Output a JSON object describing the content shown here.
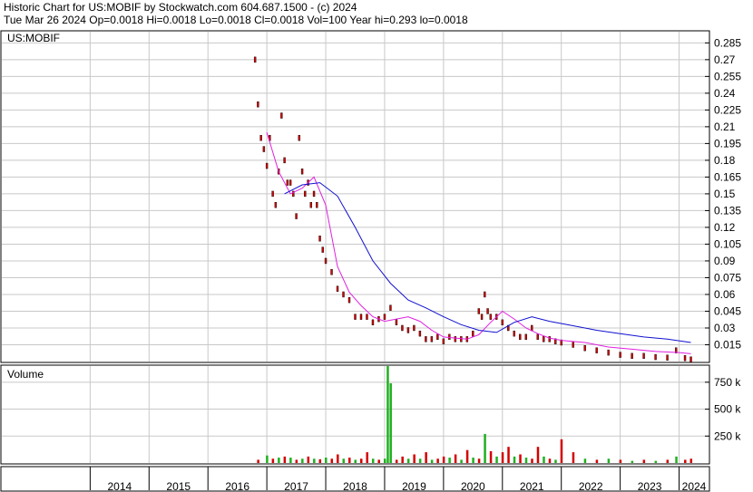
{
  "header": {
    "title_line": "Historic Chart for US:MOBIF by Stockwatch.com 604.687.1500 - (c) 2024",
    "quote_line": "Tue Mar 26 2024  Op=0.0018  Hi=0.0018  Lo=0.0018  Cl=0.0018  Vol=100  Year hi=0.293  lo=0.0018"
  },
  "chart_data": [
    {
      "type": "line",
      "panel": "price",
      "title": "US:MOBIF",
      "y_tick_labels": [
        "0.285",
        "0.27",
        "0.255",
        "0.24",
        "0.225",
        "0.21",
        "0.195",
        "0.18",
        "0.165",
        "0.15",
        "0.135",
        "0.12",
        "0.105",
        "0.09",
        "0.075",
        "0.06",
        "0.045",
        "0.03",
        "0.015"
      ],
      "ylim": [
        0,
        0.295
      ],
      "x_tick_labels": [
        "2014",
        "2015",
        "2016",
        "2017",
        "2018",
        "2019",
        "2020",
        "2021",
        "2022",
        "2023",
        "2024"
      ],
      "grid": true,
      "colors": {
        "bars": "#d40000",
        "bar_outline": "#000000",
        "ma_short": "#e020e0",
        "ma_long": "#1010d0",
        "grid": "#c8c8c8"
      },
      "series": [
        {
          "kind": "price",
          "x": [
            2016.8,
            2016.85,
            2016.9,
            2016.95,
            2017.0,
            2017.05,
            2017.1,
            2017.15,
            2017.2,
            2017.25,
            2017.3,
            2017.35,
            2017.4,
            2017.45,
            2017.5,
            2017.55,
            2017.6,
            2017.65,
            2017.7,
            2017.75,
            2017.8,
            2017.85,
            2017.9,
            2017.95,
            2018.0,
            2018.1,
            2018.2,
            2018.3,
            2018.4,
            2018.5,
            2018.6,
            2018.7,
            2018.8,
            2018.9,
            2019.0,
            2019.1,
            2019.2,
            2019.3,
            2019.4,
            2019.5,
            2019.6,
            2019.7,
            2019.8,
            2019.9,
            2020.0,
            2020.1,
            2020.2,
            2020.3,
            2020.4,
            2020.5,
            2020.6,
            2020.65,
            2020.7,
            2020.75,
            2020.8,
            2020.9,
            2021.0,
            2021.1,
            2021.2,
            2021.3,
            2021.4,
            2021.5,
            2021.6,
            2021.7,
            2021.8,
            2021.9,
            2022.0,
            2022.2,
            2022.4,
            2022.6,
            2022.8,
            2023.0,
            2023.2,
            2023.4,
            2023.6,
            2023.8,
            2023.95,
            2024.1,
            2024.2
          ],
          "y": [
            0.27,
            0.23,
            0.2,
            0.19,
            0.175,
            0.2,
            0.15,
            0.14,
            0.17,
            0.22,
            0.18,
            0.16,
            0.16,
            0.15,
            0.13,
            0.2,
            0.17,
            0.15,
            0.16,
            0.14,
            0.15,
            0.14,
            0.11,
            0.1,
            0.09,
            0.08,
            0.065,
            0.06,
            0.055,
            0.04,
            0.04,
            0.04,
            0.035,
            0.038,
            0.04,
            0.048,
            0.035,
            0.03,
            0.028,
            0.03,
            0.025,
            0.02,
            0.02,
            0.022,
            0.018,
            0.022,
            0.02,
            0.02,
            0.02,
            0.025,
            0.045,
            0.04,
            0.06,
            0.045,
            0.04,
            0.04,
            0.035,
            0.03,
            0.025,
            0.022,
            0.022,
            0.03,
            0.022,
            0.02,
            0.02,
            0.018,
            0.017,
            0.015,
            0.012,
            0.01,
            0.008,
            0.006,
            0.005,
            0.005,
            0.004,
            0.0035,
            0.01,
            0.003,
            0.0018
          ]
        },
        {
          "name": "",
          "kind": "short_moving_average",
          "x": [
            2017.0,
            2017.2,
            2017.4,
            2017.6,
            2017.8,
            2018.0,
            2018.2,
            2018.4,
            2018.6,
            2018.8,
            2019.0,
            2019.2,
            2019.4,
            2019.6,
            2019.8,
            2020.0,
            2020.2,
            2020.4,
            2020.6,
            2020.8,
            2021.0,
            2021.2,
            2021.4,
            2021.6,
            2021.8,
            2022.0,
            2022.4,
            2022.8,
            2023.2,
            2023.6,
            2024.0,
            2024.2
          ],
          "y": [
            0.205,
            0.17,
            0.15,
            0.155,
            0.165,
            0.14,
            0.085,
            0.062,
            0.05,
            0.04,
            0.036,
            0.038,
            0.04,
            0.036,
            0.028,
            0.022,
            0.021,
            0.02,
            0.024,
            0.035,
            0.045,
            0.038,
            0.03,
            0.025,
            0.021,
            0.019,
            0.017,
            0.013,
            0.011,
            0.009,
            0.008,
            0.007
          ]
        },
        {
          "name": "",
          "kind": "long_moving_average",
          "x": [
            2017.3,
            2017.6,
            2017.9,
            2018.2,
            2018.5,
            2018.8,
            2019.1,
            2019.4,
            2019.7,
            2020.0,
            2020.3,
            2020.6,
            2020.9,
            2021.2,
            2021.5,
            2021.8,
            2022.2,
            2022.6,
            2023.0,
            2023.4,
            2023.8,
            2024.2
          ],
          "y": [
            0.15,
            0.158,
            0.16,
            0.148,
            0.12,
            0.09,
            0.07,
            0.055,
            0.048,
            0.04,
            0.033,
            0.028,
            0.026,
            0.035,
            0.04,
            0.036,
            0.032,
            0.028,
            0.025,
            0.022,
            0.02,
            0.017
          ]
        }
      ]
    },
    {
      "type": "bar",
      "panel": "volume",
      "title": "Volume",
      "y_tick_labels": [
        "750 k",
        "500 k",
        "250 k"
      ],
      "ylim": [
        0,
        900000
      ],
      "colors": {
        "up": "#20b020",
        "down": "#d40000"
      },
      "x": [
        2016.85,
        2017.0,
        2017.1,
        2017.2,
        2017.3,
        2017.4,
        2017.5,
        2017.6,
        2017.7,
        2017.8,
        2017.9,
        2018.0,
        2018.1,
        2018.2,
        2018.3,
        2018.4,
        2018.5,
        2018.6,
        2018.7,
        2018.8,
        2018.9,
        2019.0,
        2019.05,
        2019.1,
        2019.2,
        2019.3,
        2019.4,
        2019.5,
        2019.6,
        2019.7,
        2019.8,
        2019.9,
        2020.0,
        2020.1,
        2020.2,
        2020.3,
        2020.4,
        2020.5,
        2020.6,
        2020.7,
        2020.8,
        2020.9,
        2021.0,
        2021.1,
        2021.2,
        2021.3,
        2021.4,
        2021.5,
        2021.6,
        2021.7,
        2021.8,
        2021.9,
        2022.0,
        2022.2,
        2022.4,
        2022.6,
        2022.8,
        2023.0,
        2023.2,
        2023.4,
        2023.6,
        2023.8,
        2023.95,
        2024.1,
        2024.2
      ],
      "values": [
        30000,
        70000,
        40000,
        50000,
        60000,
        50000,
        30000,
        40000,
        60000,
        40000,
        35000,
        50000,
        40000,
        80000,
        40000,
        50000,
        30000,
        40000,
        100000,
        40000,
        30000,
        40000,
        900000,
        740000,
        30000,
        60000,
        40000,
        80000,
        40000,
        100000,
        30000,
        40000,
        60000,
        50000,
        80000,
        30000,
        120000,
        50000,
        40000,
        270000,
        110000,
        60000,
        100000,
        150000,
        60000,
        80000,
        50000,
        40000,
        150000,
        60000,
        40000,
        30000,
        220000,
        100000,
        40000,
        30000,
        40000,
        30000,
        20000,
        30000,
        20000,
        30000,
        60000,
        30000,
        40000
      ],
      "direction": [
        "down",
        "up",
        "down",
        "up",
        "down",
        "up",
        "down",
        "up",
        "down",
        "up",
        "down",
        "up",
        "down",
        "down",
        "up",
        "down",
        "up",
        "down",
        "down",
        "up",
        "down",
        "up",
        "up",
        "up",
        "down",
        "down",
        "up",
        "down",
        "up",
        "down",
        "up",
        "down",
        "down",
        "up",
        "down",
        "up",
        "down",
        "up",
        "down",
        "up",
        "down",
        "up",
        "down",
        "down",
        "up",
        "down",
        "up",
        "down",
        "down",
        "up",
        "down",
        "up",
        "down",
        "down",
        "up",
        "down",
        "up",
        "down",
        "up",
        "down",
        "up",
        "down",
        "up",
        "down",
        "down"
      ]
    }
  ]
}
